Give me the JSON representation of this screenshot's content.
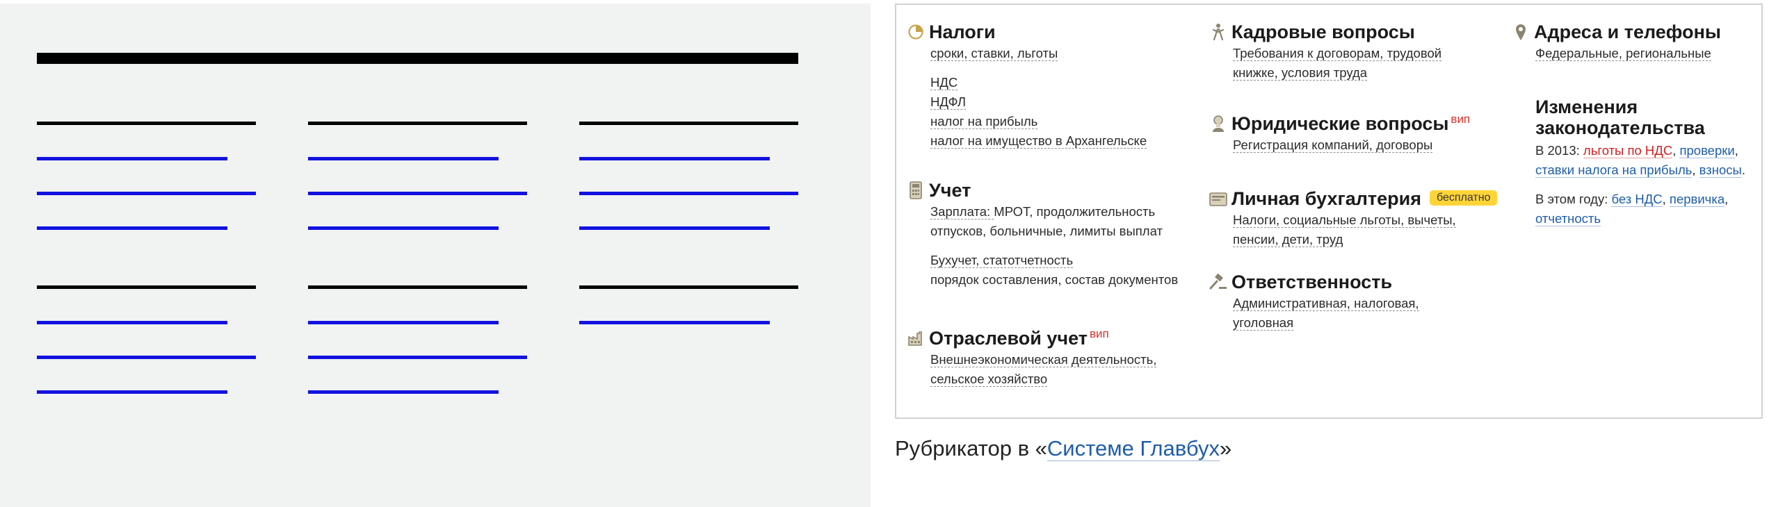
{
  "panel": {
    "col1": {
      "taxes": {
        "title": "Налоги",
        "subtitle": "сроки, ставки, льготы",
        "items": [
          "НДС",
          "НДФЛ",
          "налог на прибыль",
          "налог на имущество в Архангельске"
        ]
      },
      "accounting": {
        "title": "Учет",
        "line1_prefix": "Зарплата: ",
        "line1_rest": "МРОТ, продолжительность",
        "line2": "отпусков, больничные, лимиты выплат",
        "line3": "Бухучет, статотчетность",
        "line4": "порядок составления, состав документов"
      },
      "industry": {
        "title": "Отраслевой учет",
        "vip": "вип",
        "line1": "Внешнеэкономическая деятельность,",
        "line2": "сельское хозяйство"
      }
    },
    "col2": {
      "hr": {
        "title": "Кадровые вопросы",
        "line1": "Требования к договорам, трудовой",
        "line2": "книжке, условия труда"
      },
      "legal": {
        "title": "Юридические вопросы",
        "vip": "вип",
        "line1": "Регистрация компаний, договоры"
      },
      "personal": {
        "title": "Личная бухгалтерия",
        "badge": "бесплатно",
        "line1": "Налоги, социальные льготы, вычеты,",
        "line2": "пенсии, дети, труд"
      },
      "liability": {
        "title": "Ответственность",
        "line1": "Административная, налоговая,",
        "line2": "уголовная"
      }
    },
    "col3": {
      "addresses": {
        "title": "Адреса и телефоны",
        "line1": "Федеральные, региональные"
      },
      "changes": {
        "title_line1": "Изменения",
        "title_line2": "законодательства",
        "l1_prefix": "В 2013: ",
        "l1_red": "льготы по НДС",
        "l1_sep": ", ",
        "l1_link": "проверки",
        "l1_end": ",",
        "l2_link1": "ставки налога на прибыль",
        "l2_sep": ", ",
        "l2_link2": "взносы",
        "l2_end": ".",
        "l3_prefix": "В этом году: ",
        "l3_link1": "без НДС",
        "l3_sep": ", ",
        "l3_link2": "первичка",
        "l3_end": ",",
        "l4_link": "отчетность"
      }
    }
  },
  "caption": {
    "prefix": "Рубрикатор в «",
    "link": "Системе Главбух",
    "suffix": "»"
  },
  "colors": {
    "wire_background": "#f1f2f2",
    "wire_heading": "#000000",
    "wire_link": "#1111e0",
    "link": "#1f5ea8",
    "vip": "#d9332b",
    "badge": "#ffd437"
  }
}
